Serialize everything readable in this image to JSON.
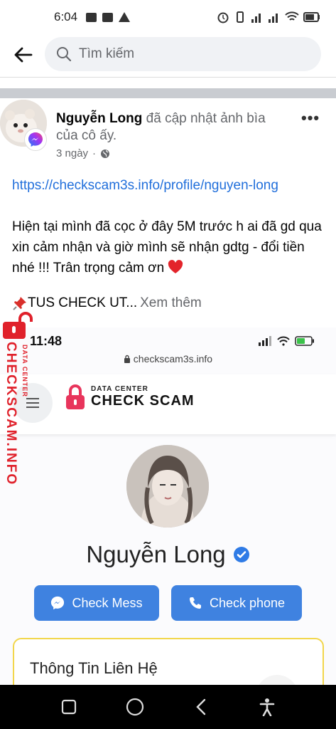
{
  "status_bar": {
    "time": "6:04"
  },
  "search": {
    "placeholder": "Tìm kiếm"
  },
  "post": {
    "author": "Nguyễn Long",
    "action": " đã cập nhật ảnh bìa của cô ấy.",
    "time": "3 ngày",
    "link": "https://checkscam3s.info/profile/nguyen-long",
    "body": "Hiện tại mình đã cọc ở đây 5M trước h ai đã gd qua xin cảm nhận và giờ mình sẽ nhận gdtg - đổi tiền nhé !!! Trân trọng cảm ơn",
    "tus_text": "TUS CHECK UT...",
    "see_more": "Xem thêm",
    "more_menu": "•••"
  },
  "embedded": {
    "time": "11:48",
    "url": "checkscam3s.info",
    "logo_small": "DATA CENTER",
    "logo_big": "CHECK SCAM",
    "profile_name": "Nguyễn Long",
    "btn_mess": "Check Mess",
    "btn_phone": "Check phone",
    "contact_title": "Thông Tin Liên Hệ"
  },
  "watermark": {
    "main": "CHECKSCAM.INFO",
    "sub": "DATA CENTER"
  },
  "colors": {
    "link": "#216fdb",
    "button": "#3f82e0",
    "watermark": "#e0212b",
    "card_border": "#f2d64b"
  }
}
